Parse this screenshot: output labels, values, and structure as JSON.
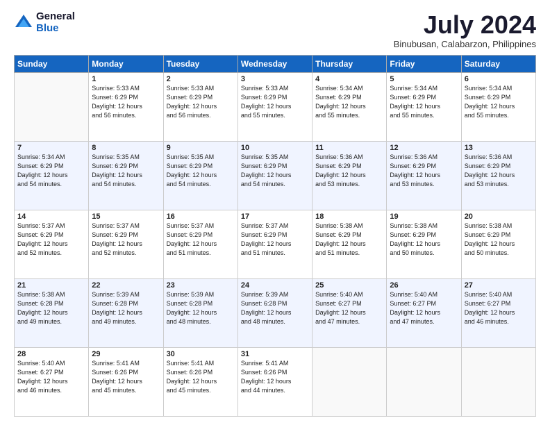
{
  "logo": {
    "general": "General",
    "blue": "Blue"
  },
  "header": {
    "month": "July 2024",
    "location": "Binubusan, Calabarzon, Philippines"
  },
  "weekdays": [
    "Sunday",
    "Monday",
    "Tuesday",
    "Wednesday",
    "Thursday",
    "Friday",
    "Saturday"
  ],
  "weeks": [
    [
      {
        "day": "",
        "info": ""
      },
      {
        "day": "1",
        "info": "Sunrise: 5:33 AM\nSunset: 6:29 PM\nDaylight: 12 hours\nand 56 minutes."
      },
      {
        "day": "2",
        "info": "Sunrise: 5:33 AM\nSunset: 6:29 PM\nDaylight: 12 hours\nand 56 minutes."
      },
      {
        "day": "3",
        "info": "Sunrise: 5:33 AM\nSunset: 6:29 PM\nDaylight: 12 hours\nand 55 minutes."
      },
      {
        "day": "4",
        "info": "Sunrise: 5:34 AM\nSunset: 6:29 PM\nDaylight: 12 hours\nand 55 minutes."
      },
      {
        "day": "5",
        "info": "Sunrise: 5:34 AM\nSunset: 6:29 PM\nDaylight: 12 hours\nand 55 minutes."
      },
      {
        "day": "6",
        "info": "Sunrise: 5:34 AM\nSunset: 6:29 PM\nDaylight: 12 hours\nand 55 minutes."
      }
    ],
    [
      {
        "day": "7",
        "info": "Sunrise: 5:34 AM\nSunset: 6:29 PM\nDaylight: 12 hours\nand 54 minutes."
      },
      {
        "day": "8",
        "info": "Sunrise: 5:35 AM\nSunset: 6:29 PM\nDaylight: 12 hours\nand 54 minutes."
      },
      {
        "day": "9",
        "info": "Sunrise: 5:35 AM\nSunset: 6:29 PM\nDaylight: 12 hours\nand 54 minutes."
      },
      {
        "day": "10",
        "info": "Sunrise: 5:35 AM\nSunset: 6:29 PM\nDaylight: 12 hours\nand 54 minutes."
      },
      {
        "day": "11",
        "info": "Sunrise: 5:36 AM\nSunset: 6:29 PM\nDaylight: 12 hours\nand 53 minutes."
      },
      {
        "day": "12",
        "info": "Sunrise: 5:36 AM\nSunset: 6:29 PM\nDaylight: 12 hours\nand 53 minutes."
      },
      {
        "day": "13",
        "info": "Sunrise: 5:36 AM\nSunset: 6:29 PM\nDaylight: 12 hours\nand 53 minutes."
      }
    ],
    [
      {
        "day": "14",
        "info": "Sunrise: 5:37 AM\nSunset: 6:29 PM\nDaylight: 12 hours\nand 52 minutes."
      },
      {
        "day": "15",
        "info": "Sunrise: 5:37 AM\nSunset: 6:29 PM\nDaylight: 12 hours\nand 52 minutes."
      },
      {
        "day": "16",
        "info": "Sunrise: 5:37 AM\nSunset: 6:29 PM\nDaylight: 12 hours\nand 51 minutes."
      },
      {
        "day": "17",
        "info": "Sunrise: 5:37 AM\nSunset: 6:29 PM\nDaylight: 12 hours\nand 51 minutes."
      },
      {
        "day": "18",
        "info": "Sunrise: 5:38 AM\nSunset: 6:29 PM\nDaylight: 12 hours\nand 51 minutes."
      },
      {
        "day": "19",
        "info": "Sunrise: 5:38 AM\nSunset: 6:29 PM\nDaylight: 12 hours\nand 50 minutes."
      },
      {
        "day": "20",
        "info": "Sunrise: 5:38 AM\nSunset: 6:29 PM\nDaylight: 12 hours\nand 50 minutes."
      }
    ],
    [
      {
        "day": "21",
        "info": "Sunrise: 5:38 AM\nSunset: 6:28 PM\nDaylight: 12 hours\nand 49 minutes."
      },
      {
        "day": "22",
        "info": "Sunrise: 5:39 AM\nSunset: 6:28 PM\nDaylight: 12 hours\nand 49 minutes."
      },
      {
        "day": "23",
        "info": "Sunrise: 5:39 AM\nSunset: 6:28 PM\nDaylight: 12 hours\nand 48 minutes."
      },
      {
        "day": "24",
        "info": "Sunrise: 5:39 AM\nSunset: 6:28 PM\nDaylight: 12 hours\nand 48 minutes."
      },
      {
        "day": "25",
        "info": "Sunrise: 5:40 AM\nSunset: 6:27 PM\nDaylight: 12 hours\nand 47 minutes."
      },
      {
        "day": "26",
        "info": "Sunrise: 5:40 AM\nSunset: 6:27 PM\nDaylight: 12 hours\nand 47 minutes."
      },
      {
        "day": "27",
        "info": "Sunrise: 5:40 AM\nSunset: 6:27 PM\nDaylight: 12 hours\nand 46 minutes."
      }
    ],
    [
      {
        "day": "28",
        "info": "Sunrise: 5:40 AM\nSunset: 6:27 PM\nDaylight: 12 hours\nand 46 minutes."
      },
      {
        "day": "29",
        "info": "Sunrise: 5:41 AM\nSunset: 6:26 PM\nDaylight: 12 hours\nand 45 minutes."
      },
      {
        "day": "30",
        "info": "Sunrise: 5:41 AM\nSunset: 6:26 PM\nDaylight: 12 hours\nand 45 minutes."
      },
      {
        "day": "31",
        "info": "Sunrise: 5:41 AM\nSunset: 6:26 PM\nDaylight: 12 hours\nand 44 minutes."
      },
      {
        "day": "",
        "info": ""
      },
      {
        "day": "",
        "info": ""
      },
      {
        "day": "",
        "info": ""
      }
    ]
  ]
}
